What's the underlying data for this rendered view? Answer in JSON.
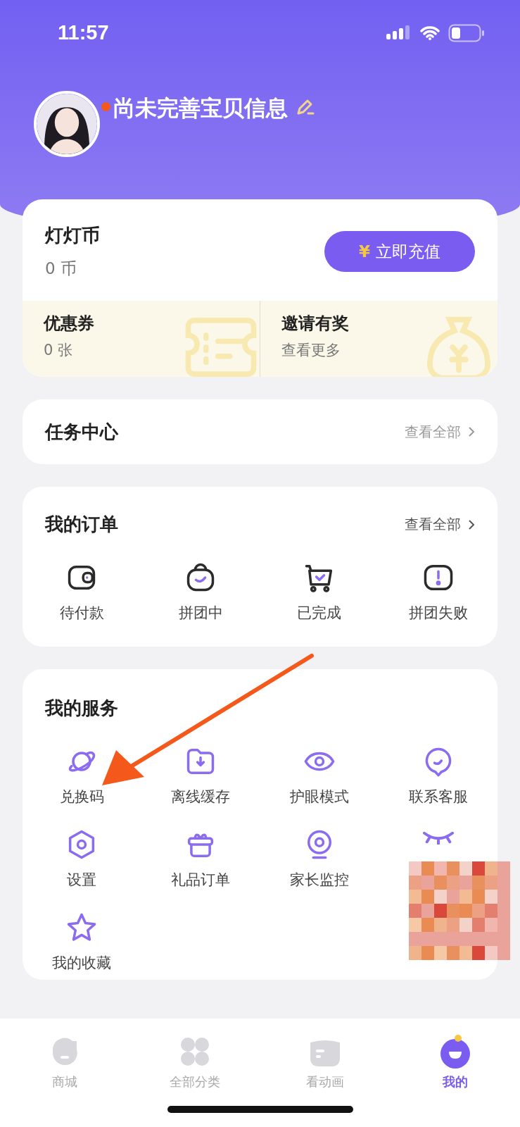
{
  "status_bar": {
    "time": "11:57"
  },
  "profile": {
    "name": "尚未完善宝贝信息",
    "unread_dot": true
  },
  "coins": {
    "title": "灯灯币",
    "amount": "0 币",
    "button": {
      "currency": "¥",
      "label": "立即充值"
    }
  },
  "perks": [
    {
      "kind": "coupon",
      "title": "优惠券",
      "subtitle": "0 张"
    },
    {
      "kind": "invite",
      "title": "邀请有奖",
      "subtitle": "查看更多"
    }
  ],
  "tasks": {
    "title": "任务中心",
    "link": "查看全部"
  },
  "orders": {
    "title": "我的订单",
    "link": "查看全部",
    "items": [
      {
        "kind": "wallet",
        "label": "待付款"
      },
      {
        "kind": "bag",
        "label": "拼团中"
      },
      {
        "kind": "cart",
        "label": "已完成"
      },
      {
        "kind": "alert",
        "label": "拼团失败"
      }
    ]
  },
  "services": {
    "title": "我的服务",
    "items": [
      {
        "kind": "planet",
        "label": "兑换码"
      },
      {
        "kind": "download",
        "label": "离线缓存"
      },
      {
        "kind": "eye",
        "label": "护眼模式"
      },
      {
        "kind": "chat",
        "label": "联系客服"
      },
      {
        "kind": "gear",
        "label": "设置"
      },
      {
        "kind": "gift",
        "label": "礼品订单"
      },
      {
        "kind": "camera",
        "label": "家长监控"
      },
      {
        "kind": "sleep"
      },
      {
        "kind": "star",
        "label": "我的收藏"
      }
    ]
  },
  "tab_bar": [
    {
      "kind": "shop",
      "label": "商城",
      "selected": false
    },
    {
      "kind": "grid",
      "label": "全部分类",
      "selected": false
    },
    {
      "kind": "cartoon",
      "label": "看动画",
      "selected": false
    },
    {
      "kind": "me",
      "label": "我的",
      "selected": true
    }
  ]
}
